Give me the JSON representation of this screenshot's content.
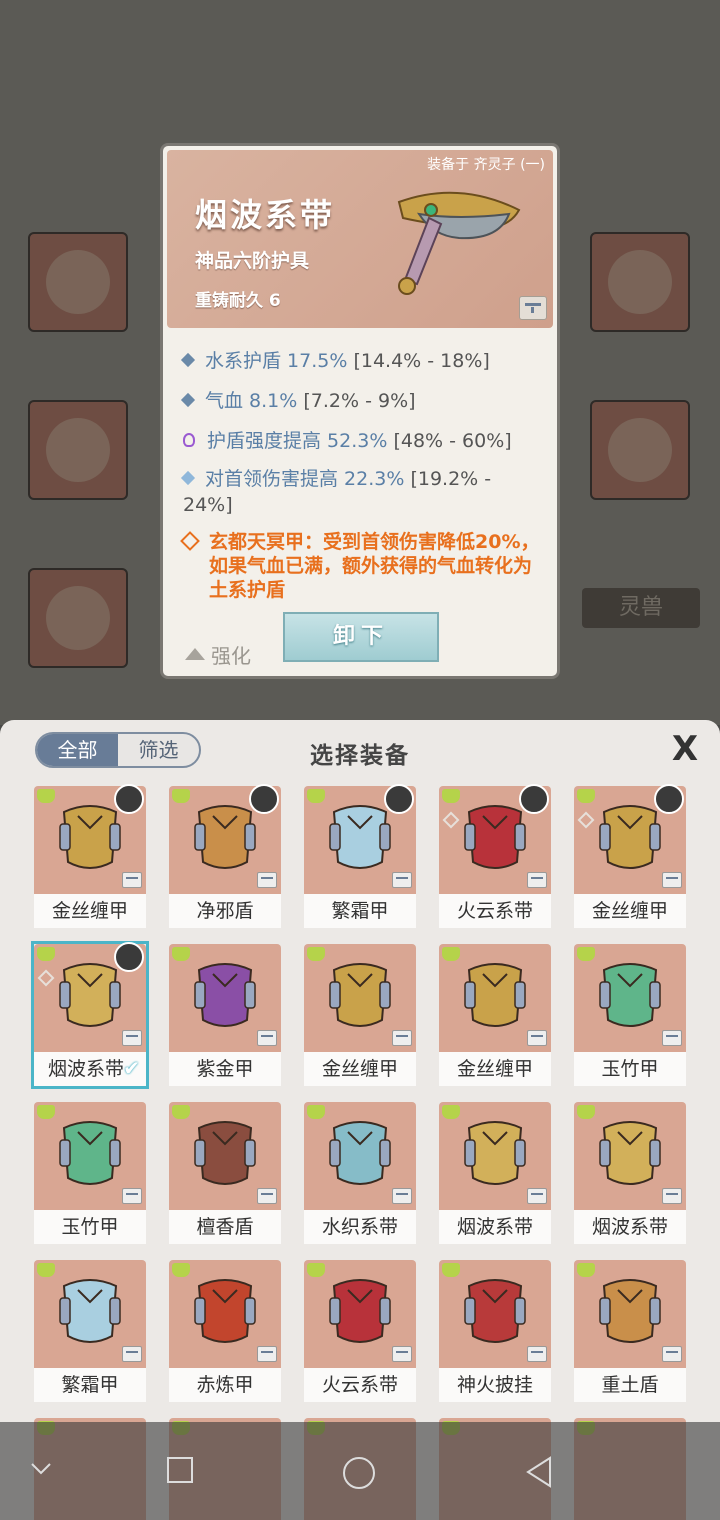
{
  "detail": {
    "equipped_on": "装备于 齐灵子 (一)",
    "name": "烟波系带",
    "grade": "神品六阶护具",
    "durability": "重铸耐久 6",
    "attributes": [
      {
        "name": "水系护盾 17.5%",
        "range": "[14.4% - 18%]"
      },
      {
        "name": "气血 8.1%",
        "range": "[7.2% - 9%]"
      },
      {
        "name": "护盾强度提高 52.3%",
        "range": "[48% - 60%]"
      },
      {
        "name": "对首领伤害提高 22.3%",
        "range": "[19.2% - 24%]"
      }
    ],
    "special": "玄都天冥甲：受到首领伤害降低20%，如果气血已满，额外获得的气血转化为土系护盾",
    "enhance_label": "强化",
    "unequip_label": "卸下"
  },
  "background": {
    "side_label": "灵兽"
  },
  "panel": {
    "tabs": [
      "全部",
      "筛选"
    ],
    "title": "选择装备",
    "close": "X",
    "items": [
      {
        "label": "金丝缠甲",
        "color": "#c9a24a"
      },
      {
        "label": "净邪盾",
        "color": "#c98f4a"
      },
      {
        "label": "繁霜甲",
        "color": "#a9cfe0"
      },
      {
        "label": "火云系带",
        "color": "#b8323a"
      },
      {
        "label": "金丝缠甲",
        "color": "#c9a24a"
      },
      {
        "label": "烟波系带",
        "color": "#d2b05a"
      },
      {
        "label": "紫金甲",
        "color": "#8a4fa6"
      },
      {
        "label": "金丝缠甲",
        "color": "#c9a24a"
      },
      {
        "label": "金丝缠甲",
        "color": "#c9a24a"
      },
      {
        "label": "玉竹甲",
        "color": "#5fb58a"
      },
      {
        "label": "玉竹甲",
        "color": "#5fb58a"
      },
      {
        "label": "檀香盾",
        "color": "#8a4d3f"
      },
      {
        "label": "水织系带",
        "color": "#86bcc8"
      },
      {
        "label": "烟波系带",
        "color": "#d2b05a"
      },
      {
        "label": "烟波系带",
        "color": "#d2b05a"
      },
      {
        "label": "繁霜甲",
        "color": "#a9cfe0"
      },
      {
        "label": "赤炼甲",
        "color": "#c2452d"
      },
      {
        "label": "火云系带",
        "color": "#b8323a"
      },
      {
        "label": "神火披挂",
        "color": "#b83a3a"
      },
      {
        "label": "重土盾",
        "color": "#c98f4a"
      }
    ]
  }
}
